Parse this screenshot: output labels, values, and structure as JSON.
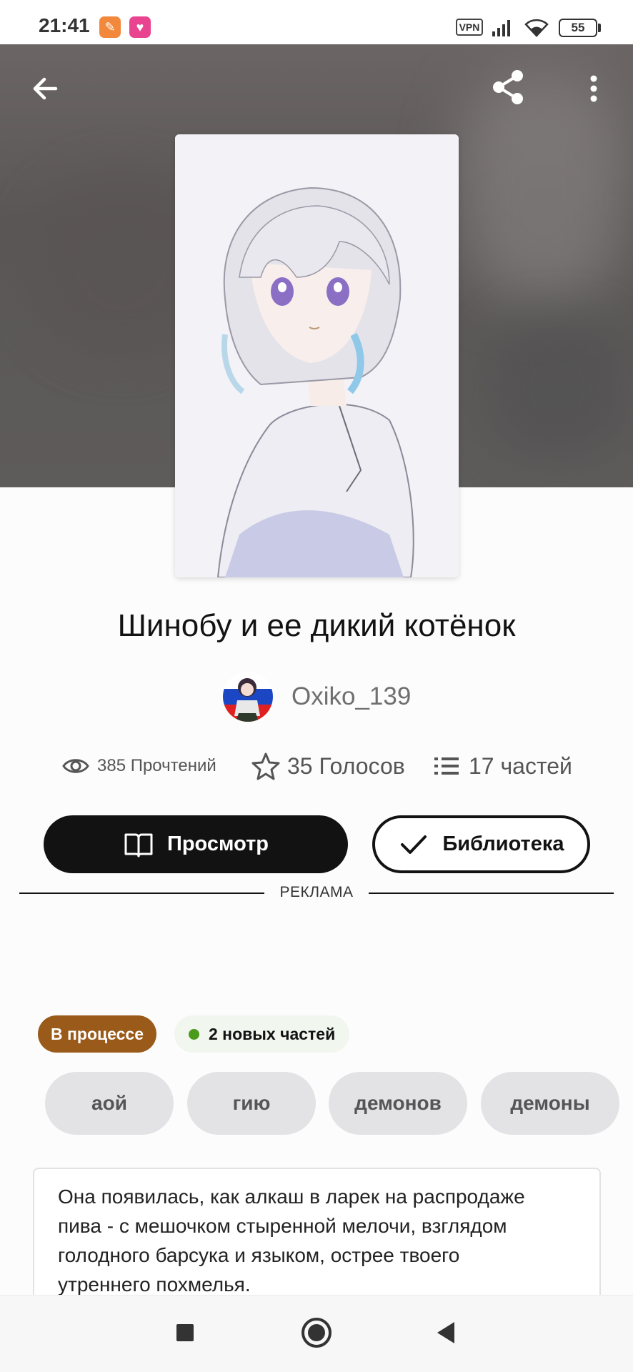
{
  "status_bar": {
    "time": "21:41",
    "vpn": "VPN",
    "battery": "55"
  },
  "header": {
    "back_icon": "arrow-left-icon",
    "share_icon": "share-icon",
    "more_icon": "more-vertical-icon"
  },
  "story": {
    "title": "Шинобу и ее дикий котёнок",
    "author": "Oxiko_139"
  },
  "stats": {
    "reads": "385 Прочтений",
    "votes": "35 Голосов",
    "parts": "17 частей"
  },
  "actions": {
    "read_label": "Просмотр",
    "library_label": "Библиотека"
  },
  "ad_label": "РЕКЛАМА",
  "badges": {
    "status": "В процессе",
    "new_parts": "2 новых частей"
  },
  "tags": [
    "аой",
    "гию",
    "демонов",
    "демоны"
  ],
  "description": {
    "lines": [
      "Она появилась, как алкаш в ларек на распродаже",
      "пива - с мешочком стыренной мелочи, взглядом",
      "голодного барсука и языком, острее твоего",
      "утреннего похмелья."
    ]
  },
  "colors": {
    "status_badge": "#9a5a1a",
    "new_dot": "#4a9a1b",
    "primary_button": "#121212"
  }
}
